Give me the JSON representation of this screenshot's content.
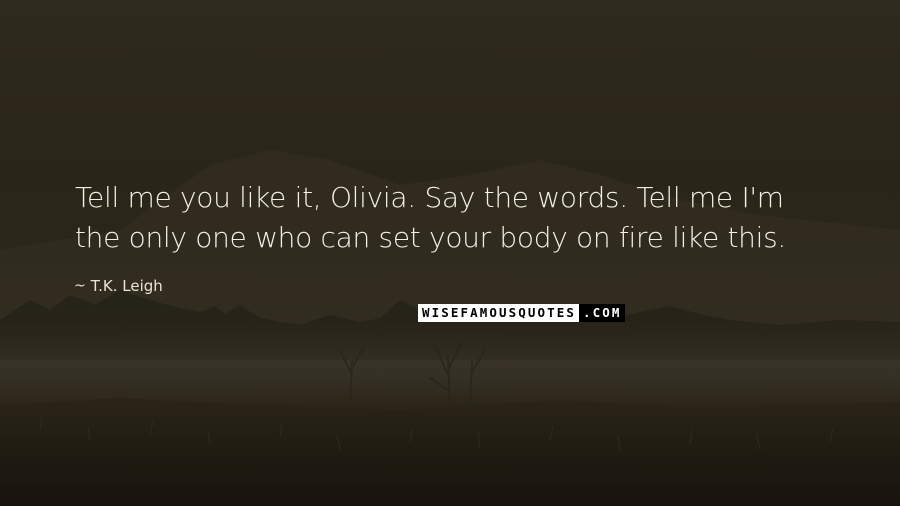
{
  "quote": {
    "line1": "Tell me you like it, Olivia. Say the words. Tell me I'm",
    "line2": "the only one who can set your body on fire like this."
  },
  "author": {
    "dash": "~",
    "name": "T.K. Leigh"
  },
  "watermark": {
    "text": "WISEFAMOUSQUOTES.COM",
    "part_light": "WISEFAMOUSQUOTES",
    "part_dark": ".COM"
  }
}
